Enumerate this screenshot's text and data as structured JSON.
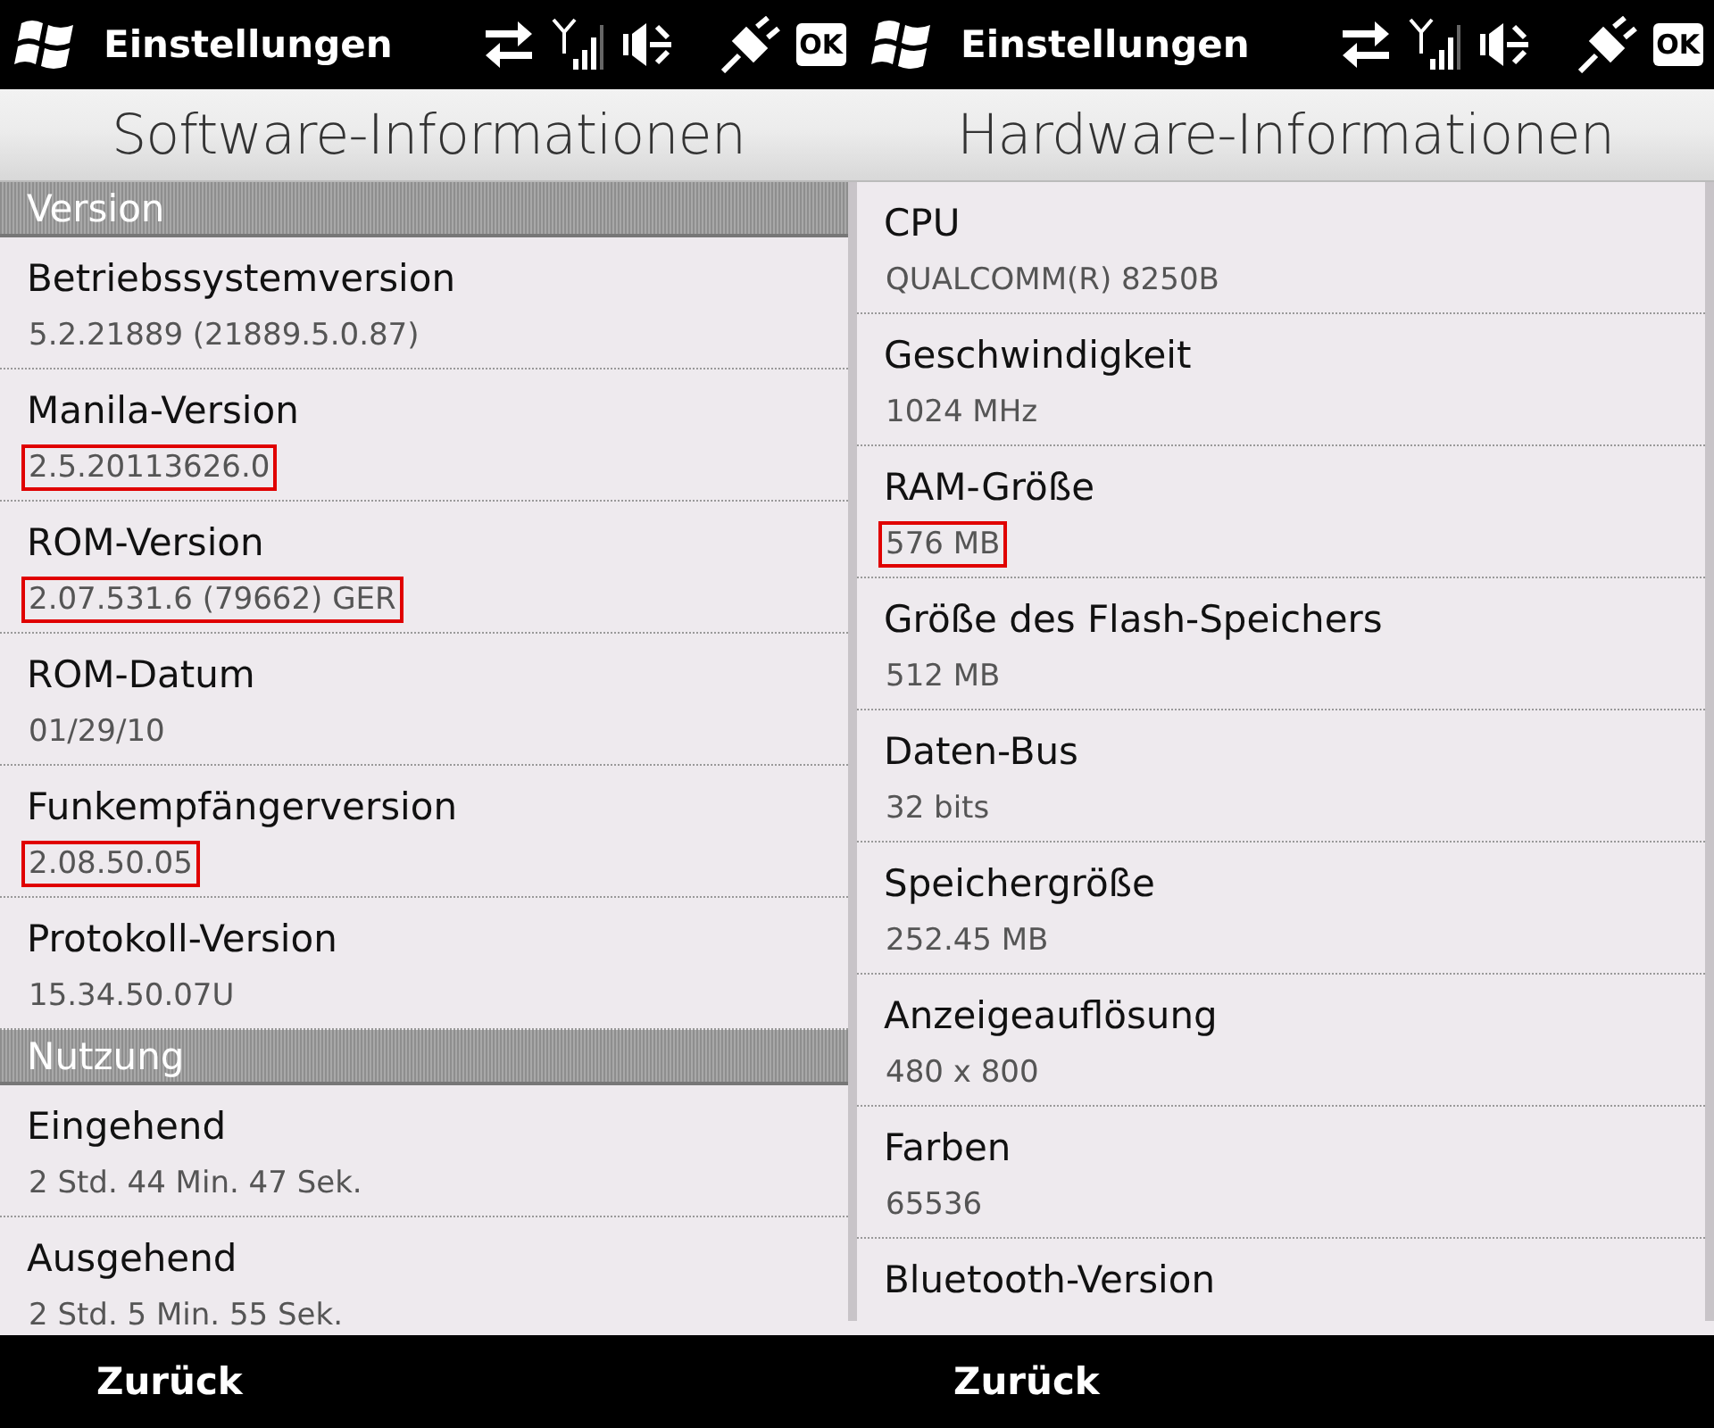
{
  "panels": [
    {
      "status_bar": {
        "title": "Einstellungen",
        "ok": "OK"
      },
      "heading": "Software-Informationen",
      "items": [
        {
          "kind": "section",
          "label": "Version"
        },
        {
          "kind": "entry",
          "label": "Betriebssystemversion",
          "value": "5.2.21889 (21889.5.0.87)",
          "highlighted": false
        },
        {
          "kind": "entry",
          "label": "Manila-Version",
          "value": "2.5.20113626.0",
          "highlighted": true
        },
        {
          "kind": "entry",
          "label": "ROM-Version",
          "value": "2.07.531.6 (79662) GER",
          "highlighted": true
        },
        {
          "kind": "entry",
          "label": "ROM-Datum",
          "value": "01/29/10",
          "highlighted": false
        },
        {
          "kind": "entry",
          "label": "Funkempfängerversion",
          "value": "2.08.50.05",
          "highlighted": true
        },
        {
          "kind": "entry",
          "label": "Protokoll-Version",
          "value": "15.34.50.07U",
          "highlighted": false
        },
        {
          "kind": "section",
          "label": "Nutzung"
        },
        {
          "kind": "entry",
          "label": "Eingehend",
          "value": "2 Std. 44 Min. 47 Sek.",
          "highlighted": false
        },
        {
          "kind": "entry",
          "label": "Ausgehend",
          "value": "2 Std. 5 Min. 55 Sek.",
          "highlighted": false
        }
      ],
      "softkey": "Zurück"
    },
    {
      "status_bar": {
        "title": "Einstellungen",
        "ok": "OK"
      },
      "heading": "Hardware-Informationen",
      "items": [
        {
          "kind": "entry",
          "label": "CPU",
          "value": "QUALCOMM(R) 8250B",
          "highlighted": false
        },
        {
          "kind": "entry",
          "label": "Geschwindigkeit",
          "value": "1024 MHz",
          "highlighted": false
        },
        {
          "kind": "entry",
          "label": "RAM-Größe",
          "value": "576 MB",
          "highlighted": true
        },
        {
          "kind": "entry",
          "label": "Größe des Flash-Speichers",
          "value": "512 MB",
          "highlighted": false
        },
        {
          "kind": "entry",
          "label": "Daten-Bus",
          "value": "32 bits",
          "highlighted": false
        },
        {
          "kind": "entry",
          "label": "Speichergröße",
          "value": "252.45 MB",
          "highlighted": false
        },
        {
          "kind": "entry",
          "label": "Anzeigeauflösung",
          "value": "480 x 800",
          "highlighted": false
        },
        {
          "kind": "entry",
          "label": "Farben",
          "value": "65536",
          "highlighted": false
        },
        {
          "kind": "entry",
          "label": "Bluetooth-Version"
        }
      ],
      "softkey": "Zurück"
    }
  ]
}
